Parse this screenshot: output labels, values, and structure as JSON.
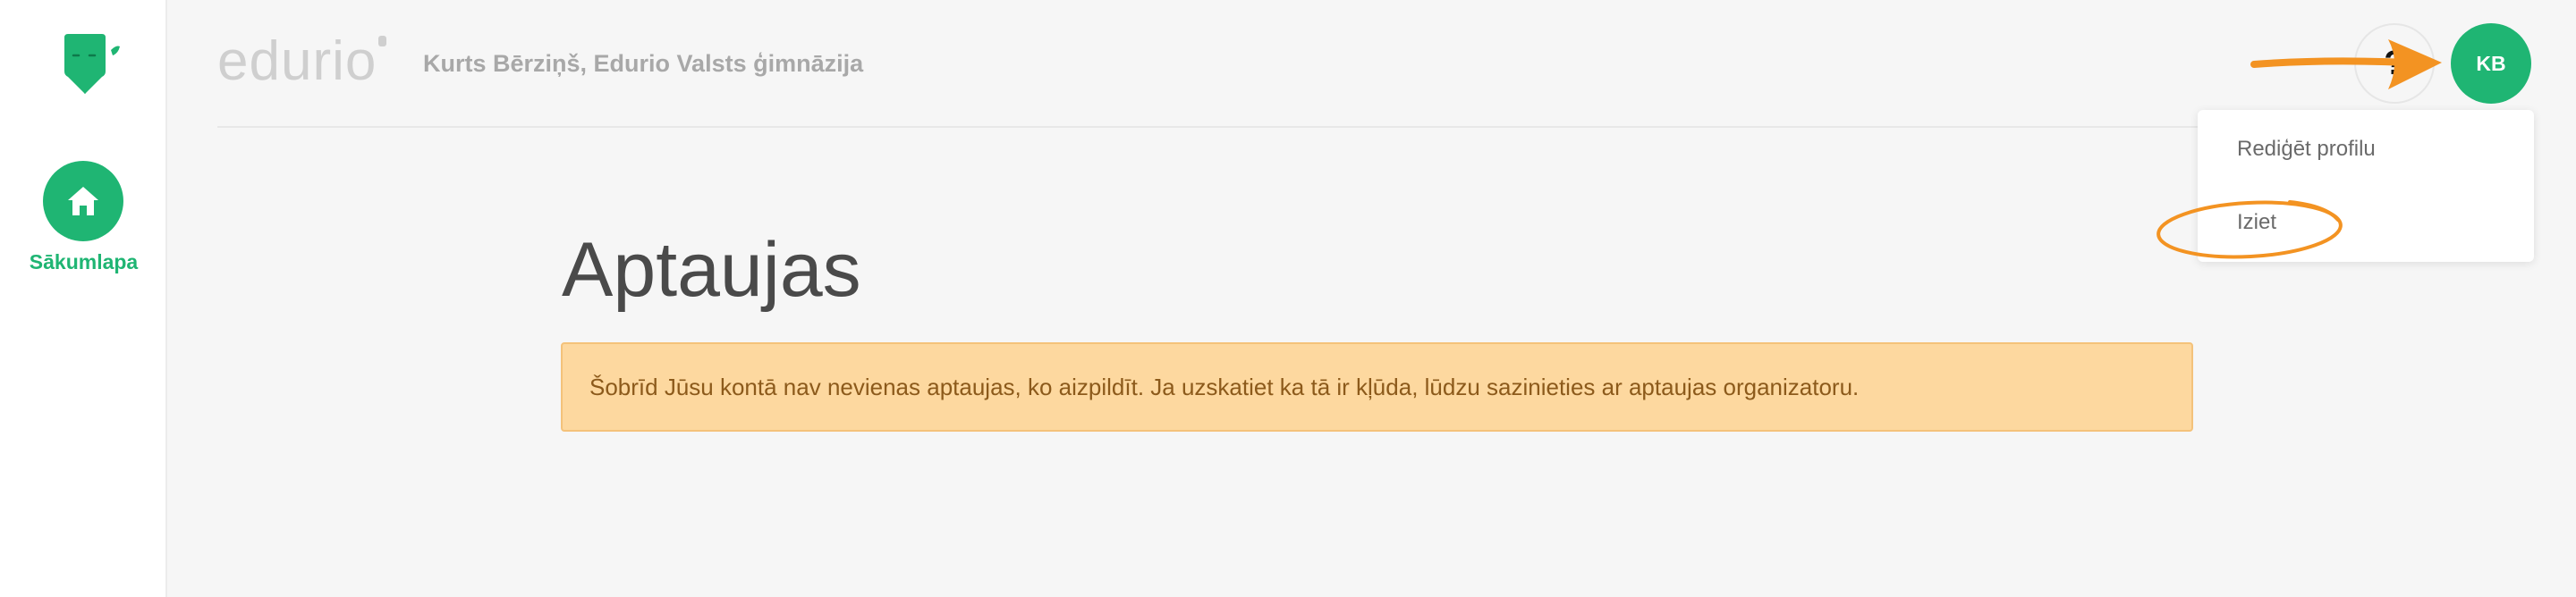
{
  "sidebar": {
    "home_label": "Sākumlapa"
  },
  "header": {
    "brand": "edurio",
    "user_org": "Kurts Bērziņš, Edurio Valsts ģimnāzija",
    "help_glyph": "?",
    "avatar_initials": "KB"
  },
  "dropdown": {
    "items": [
      {
        "label": "Rediģēt profilu"
      },
      {
        "label": "Iziet"
      }
    ]
  },
  "main": {
    "title": "Aptaujas",
    "alert": "Šobrīd Jūsu kontā nav nevienas aptaujas, ko aizpildīt. Ja uzskatiet ka tā ir kļūda, lūdzu sazinieties ar aptaujas organizatoru."
  },
  "colors": {
    "brand_green": "#1fb573",
    "alert_bg": "#fdd89f",
    "alert_text": "#8c5a1b",
    "annotation_orange": "#f39322"
  },
  "icons": {
    "logo": "edurio-logo-icon",
    "home": "home-icon",
    "help": "help-icon"
  }
}
